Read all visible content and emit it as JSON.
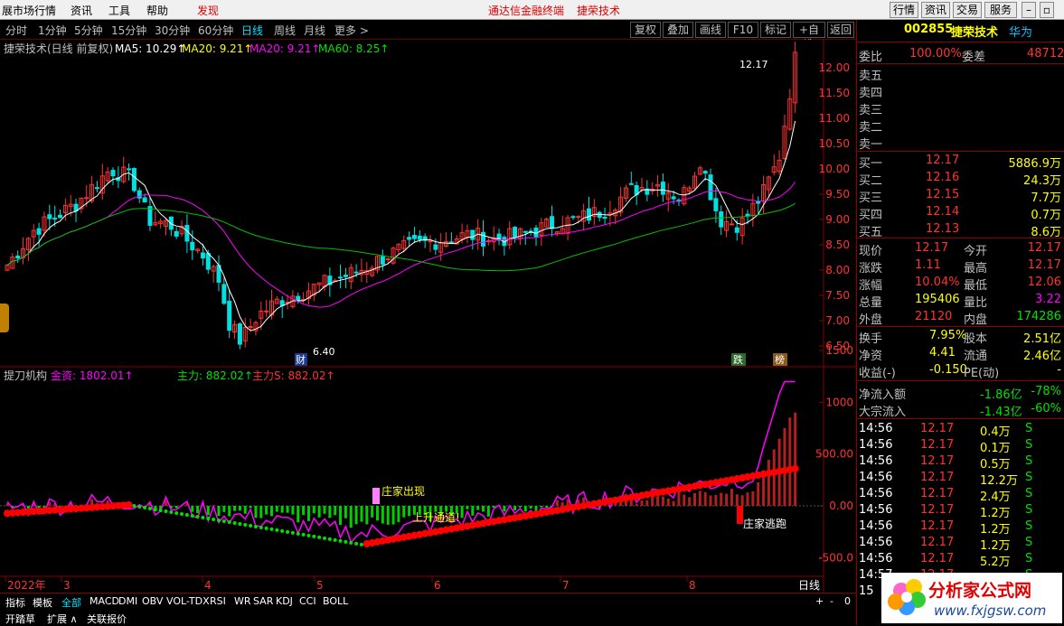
{
  "menubar": {
    "items": [
      "展市场行情",
      "资讯",
      "工具",
      "帮助"
    ],
    "discover": "发现",
    "center_title": "通达信金融终端",
    "center_stock": "捷荣技术",
    "right_buttons": [
      "行情",
      "资讯",
      "交易",
      "服务"
    ]
  },
  "toolbar": {
    "periods": [
      "分时",
      "1分钟",
      "5分钟",
      "15分钟",
      "30分钟",
      "60分钟",
      "日线",
      "周线",
      "月线",
      "更多 >"
    ],
    "active_period": "日线",
    "right_buttons": [
      "复权",
      "叠加",
      "画线",
      "F10",
      "标记",
      "+自选",
      "返回"
    ]
  },
  "main_chart": {
    "title": "捷荣技术(日线 前复权)",
    "ma5": "MA5: 10.29↑",
    "ma20a": "MA20: 9.21↑",
    "ma20b": "MA20: 9.21↑",
    "ma60": "MA60: 8.25↑",
    "high_label": "12.17",
    "low_label": "6.40",
    "badge_cai": "财",
    "badge_die": "跌",
    "badge_bang": "榜",
    "price_axis": [
      "12.00",
      "11.50",
      "11.00",
      "10.50",
      "10.00",
      "9.50",
      "9.00",
      "8.50",
      "8.00",
      "7.50",
      "7.00",
      "6.50"
    ],
    "colors": {
      "up": "#ff3232",
      "down": "#00e0e0",
      "ma5": "#ffffff",
      "ma20": "#ff00ff",
      "ma60": "#00c000"
    }
  },
  "sub_chart": {
    "title": "提刀机构",
    "jinzi": "金资: 1802.01↑",
    "zhuli": "主力: 882.02↑",
    "zhulis": "主力S: 882.02↑",
    "ann_zhuangjia": "庄家出现",
    "ann_shangsheng": "上升通道!",
    "ann_taopao": "庄家逃跑",
    "axis": [
      "1500",
      "1000",
      "500.00",
      "0.00",
      "-500.0"
    ]
  },
  "time_axis": {
    "labels": [
      "2022年",
      "3",
      "4",
      "5",
      "6",
      "7",
      "8"
    ],
    "period": "日线"
  },
  "bottom_tabs": [
    "指标",
    "模板",
    "全部",
    "MACD",
    "DMI",
    "OBV",
    "VOL-TDX",
    "RSI",
    "WR",
    "SAR",
    "KDJ",
    "CCI",
    "BOLL"
  ],
  "bottom_tabs2": [
    "开踏草",
    "扩展 ∧",
    "关联报价"
  ],
  "quote": {
    "code": "002855",
    "name": "捷荣技术",
    "tag": "华为",
    "weibi_label": "委比",
    "weibi": "100.00%",
    "weicha_label": "委差",
    "weicha": "48712",
    "sell": [
      {
        "label": "卖五",
        "price": "",
        "vol": ""
      },
      {
        "label": "卖四",
        "price": "",
        "vol": ""
      },
      {
        "label": "卖三",
        "price": "",
        "vol": ""
      },
      {
        "label": "卖二",
        "price": "",
        "vol": ""
      },
      {
        "label": "卖一",
        "price": "",
        "vol": ""
      }
    ],
    "buy": [
      {
        "label": "买一",
        "price": "12.17",
        "vol": "5886.9万"
      },
      {
        "label": "买二",
        "price": "12.16",
        "vol": "24.3万"
      },
      {
        "label": "买三",
        "price": "12.15",
        "vol": "7.7万"
      },
      {
        "label": "买四",
        "price": "12.14",
        "vol": "0.7万"
      },
      {
        "label": "买五",
        "price": "12.13",
        "vol": "8.6万"
      }
    ],
    "stats": [
      {
        "l1": "现价",
        "v1": "12.17",
        "l2": "今开",
        "v2": "12.17"
      },
      {
        "l1": "涨跌",
        "v1": "1.11",
        "l2": "最高",
        "v2": "12.17"
      },
      {
        "l1": "涨幅",
        "v1": "10.04%",
        "l2": "最低",
        "v2": "12.06"
      },
      {
        "l1": "总量",
        "v1": "195406",
        "l2": "量比",
        "v2": "3.22"
      },
      {
        "l1": "外盘",
        "v1": "21120",
        "l2": "内盘",
        "v2": "174286"
      }
    ],
    "stats2": [
      {
        "l1": "换手",
        "v1": "7.95%",
        "l2": "股本",
        "v2": "2.51亿"
      },
      {
        "l1": "净资",
        "v1": "4.41",
        "l2": "流通",
        "v2": "2.46亿"
      },
      {
        "l1": "收益(-)",
        "v1": "-0.150",
        "l2": "PE(动)",
        "v2": "-"
      }
    ],
    "flows": [
      {
        "label": "净流入额",
        "val": "-1.86亿",
        "pct": "-78%"
      },
      {
        "label": "大宗流入",
        "val": "-1.43亿",
        "pct": "-60%"
      }
    ],
    "ticks": [
      {
        "t": "14:56",
        "p": "12.17",
        "v": "0.4万",
        "s": "S"
      },
      {
        "t": "14:56",
        "p": "12.17",
        "v": "0.1万",
        "s": "S"
      },
      {
        "t": "14:56",
        "p": "12.17",
        "v": "0.5万",
        "s": "S"
      },
      {
        "t": "14:56",
        "p": "12.17",
        "v": "12.2万",
        "s": "S"
      },
      {
        "t": "14:56",
        "p": "12.17",
        "v": "2.4万",
        "s": "S"
      },
      {
        "t": "14:56",
        "p": "12.17",
        "v": "1.2万",
        "s": "S"
      },
      {
        "t": "14:56",
        "p": "12.17",
        "v": "1.2万",
        "s": "S"
      },
      {
        "t": "14:56",
        "p": "12.17",
        "v": "1.2万",
        "s": "S"
      },
      {
        "t": "14:56",
        "p": "12.17",
        "v": "5.2万",
        "s": "S"
      },
      {
        "t": "14:57",
        "p": "12.17",
        "v": "1.0万",
        "s": "S"
      },
      {
        "t": "15",
        "p": "",
        "v": "",
        "s": ""
      }
    ]
  },
  "watermark": {
    "cn": "分析家公式网",
    "url": "www.fxjgsw.com"
  }
}
